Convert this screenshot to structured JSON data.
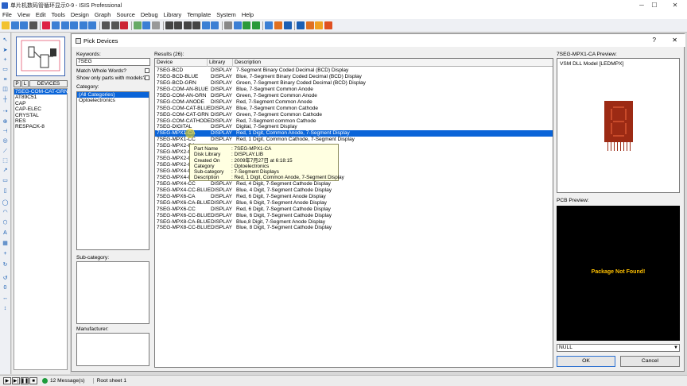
{
  "app": {
    "title": "单片机数码管循环显示0-9 - ISIS Professional"
  },
  "menu": [
    "File",
    "View",
    "Edit",
    "Tools",
    "Design",
    "Graph",
    "Source",
    "Debug",
    "Library",
    "Template",
    "System",
    "Help"
  ],
  "selector": {
    "p_label": "P",
    "l_label": "L",
    "tab_label": "DEVICES",
    "devices": [
      "7SEG-COM-CAT-GRN",
      "AT89C51",
      "CAP",
      "CAP-ELEC",
      "CRYSTAL",
      "RES",
      "RESPACK-8"
    ],
    "selected_index": 0
  },
  "status": {
    "messages": "12 Message(s)",
    "sheet": "Root sheet 1"
  },
  "dialog": {
    "title": "Pick Devices",
    "help": "?",
    "close": "✕",
    "keywords_label": "Keywords:",
    "keywords_value": "7SEG",
    "match_whole_words": "Match Whole Words?",
    "show_models": "Show only parts with models?",
    "category_label": "Category:",
    "categories": [
      "(All Categories)",
      "Optoelectronics"
    ],
    "subcategory_label": "Sub-category:",
    "manufacturer_label": "Manufacturer:",
    "results_label": "Results (26):",
    "columns": [
      "Device",
      "Library",
      "Description"
    ],
    "rows": [
      [
        "7SEG-BCD",
        "DISPLAY",
        "7-Segment Binary Coded Decimal (BCD) Display"
      ],
      [
        "7SEG-BCD-BLUE",
        "DISPLAY",
        "Blue, 7-Segment Binary Coded Decimal (BCD) Display"
      ],
      [
        "7SEG-BCD-GRN",
        "DISPLAY",
        "Green, 7-Segment Binary Coded Decimal (BCD) Display"
      ],
      [
        "7SEG-COM-AN-BLUE",
        "DISPLAY",
        "Blue, 7-Segment Common Anode"
      ],
      [
        "7SEG-COM-AN-GRN",
        "DISPLAY",
        "Green, 7-Segment Common Anode"
      ],
      [
        "7SEG-COM-ANODE",
        "DISPLAY",
        "Red, 7-Segment Common Anode"
      ],
      [
        "7SEG-COM-CAT-BLUE",
        "DISPLAY",
        "Blue, 7-Segment Common Cathode"
      ],
      [
        "7SEG-COM-CAT-GRN",
        "DISPLAY",
        "Green, 7-Segment Common Cathode"
      ],
      [
        "7SEG-COM-CATHODE",
        "DISPLAY",
        "Red, 7-Segment common Cathode"
      ],
      [
        "7SEG-DIGITAL",
        "DISPLAY",
        "Digital, 7-Segment Display"
      ],
      [
        "7SEG-MPX1-CA",
        "DISPLAY",
        "Red, 1 Digit, Common Anode, 7-Segment Display"
      ],
      [
        "7SEG-MPX1-CC",
        "DISPLAY",
        "Red, 1 Digit, Common Cathode, 7-Segment Display"
      ],
      [
        "7SEG-MPX2-CA",
        "",
        ""
      ],
      [
        "7SEG-MPX2-CA",
        "",
        ""
      ],
      [
        "7SEG-MPX2-CC",
        "",
        ""
      ],
      [
        "7SEG-MPX2-CC",
        "",
        ""
      ],
      [
        "7SEG-MPX4-CA",
        "",
        ""
      ],
      [
        "7SEG-MPX4-CA",
        "",
        ""
      ],
      [
        "7SEG-MPX4-CC",
        "DISPLAY",
        "Red, 4 Digit, 7-Segment Cathode Display"
      ],
      [
        "7SEG-MPX4-CC-BLUE",
        "DISPLAY",
        "Blue, 4 Digit, 7-Segment Cathode Display"
      ],
      [
        "7SEG-MPX6-CA",
        "DISPLAY",
        "Red, 6 Digit, 7-Segment Anode Display"
      ],
      [
        "7SEG-MPX6-CA-BLUE",
        "DISPLAY",
        "Blue, 6 Digit, 7-Segment Anode Display"
      ],
      [
        "7SEG-MPX6-CC",
        "DISPLAY",
        "Red, 6 Digit, 7-Segment Cathode Display"
      ],
      [
        "7SEG-MPX6-CC-BLUE",
        "DISPLAY",
        "Blue, 6 Digit, 7-Segment Cathode Display"
      ],
      [
        "7SEG-MPX8-CA-BLUE",
        "DISPLAY",
        "Blue,8 Digit, 7-Segment Anode Display"
      ],
      [
        "7SEG-MPX8-CC-BLUE",
        "DISPLAY",
        "Blue, 8 Digit, 7-Segment Cathode Display"
      ]
    ],
    "selected_row": 10,
    "tooltip": [
      [
        "Part Name",
        ": 7SEG-MPX1-CA"
      ],
      [
        "Disk Library",
        ": DISPLAY.LIB"
      ],
      [
        "Created On",
        ": 2009年7月27日  at 6:18:15"
      ],
      [
        "Category",
        ": Optoelectronics"
      ],
      [
        "Sub-category",
        ": 7-Segment Displays"
      ],
      [
        "Description",
        ": Red, 1 Digit, Common Anode, 7-Segment Display"
      ]
    ],
    "schematic_preview_label": "7SEG-MPX1-CA Preview:",
    "model_text": "VSM DLL Model [LEDMPX]",
    "pcb_preview_label": "PCB Preview:",
    "pcb_message": "Package Not Found!",
    "footprint_value": "NULL",
    "ok_label": "OK",
    "cancel_label": "Cancel"
  },
  "colors": {
    "selection": "#0a64d8",
    "pcb_message": "#ffc000",
    "display_body": "#9c2a14"
  }
}
